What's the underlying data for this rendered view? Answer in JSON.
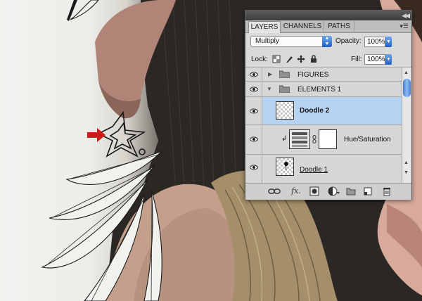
{
  "panel": {
    "tabs": [
      {
        "label": "LAYERS",
        "active": true
      },
      {
        "label": "CHANNELS",
        "active": false
      },
      {
        "label": "PATHS",
        "active": false
      }
    ],
    "blend_mode": "Multiply",
    "opacity_label": "Opacity:",
    "opacity_value": "100%",
    "lock_label": "Lock:",
    "fill_label": "Fill:",
    "fill_value": "100%"
  },
  "layers": [
    {
      "name": "FIGURES",
      "type": "group",
      "expanded": false,
      "visible": true
    },
    {
      "name": "ELEMENTS 1",
      "type": "group",
      "expanded": true,
      "visible": true
    },
    {
      "name": "Doodle 2",
      "type": "layer",
      "selected": true,
      "visible": false
    },
    {
      "name": "Hue/Saturation",
      "type": "adjustment",
      "clipped": true,
      "visible": true
    },
    {
      "name": "Doodle 1",
      "type": "layer",
      "visible": true
    }
  ],
  "colors": {
    "selection": "#b7d3f3",
    "accent_blue": "#1f5fc4",
    "arrow_red": "#cc1a1a"
  }
}
